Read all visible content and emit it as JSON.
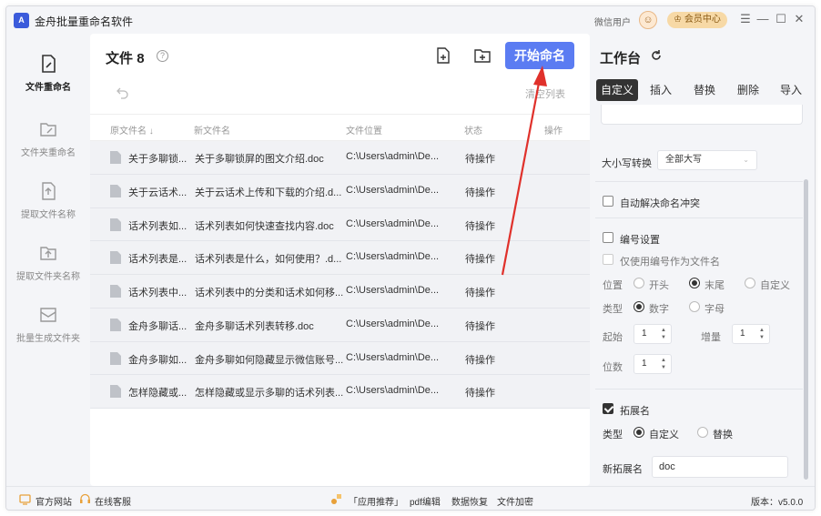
{
  "app": {
    "title": "金舟批量重命名软件",
    "logo_text": "A",
    "wx_user": "微信用户",
    "vip_label": "会员中心",
    "colors": {
      "accent": "#5b7cf2",
      "annotation": "#e0312b",
      "vip_bg": "#f7d9a6"
    }
  },
  "window_controls": {
    "menu": "☰",
    "minimize": "—",
    "maximize": "☐",
    "close": "✕"
  },
  "sidebar": {
    "items": [
      {
        "label": "文件重命名",
        "icon": "file-rename-icon"
      },
      {
        "label": "文件夹重命名",
        "icon": "folder-rename-icon"
      },
      {
        "label": "提取文件名称",
        "icon": "extract-file-name-icon"
      },
      {
        "label": "提取文件夹名称",
        "icon": "extract-folder-name-icon"
      },
      {
        "label": "批量生成文件夹",
        "icon": "batch-folder-icon"
      }
    ]
  },
  "main": {
    "title_label": "文件",
    "file_count": "8",
    "help": "?",
    "start_button": "开始命名",
    "clear_list": "清空列表",
    "columns": {
      "original_name": "原文件名 ↓",
      "new_name": "新文件名",
      "location": "文件位置",
      "status": "状态",
      "action": "操作"
    },
    "rows": [
      {
        "original": "关于多聊锁...",
        "new": "关于多聊锁屏的图文介绍.doc",
        "location": "C:\\Users\\admin\\De...",
        "status": "待操作"
      },
      {
        "original": "关于云话术...",
        "new": "关于云话术上传和下载的介绍.d...",
        "location": "C:\\Users\\admin\\De...",
        "status": "待操作"
      },
      {
        "original": "话术列表如...",
        "new": "话术列表如何快速查找内容.doc",
        "location": "C:\\Users\\admin\\De...",
        "status": "待操作"
      },
      {
        "original": "话术列表是...",
        "new": "话术列表是什么，如何使用？.d...",
        "location": "C:\\Users\\admin\\De...",
        "status": "待操作"
      },
      {
        "original": "话术列表中...",
        "new": "话术列表中的分类和话术如何移...",
        "location": "C:\\Users\\admin\\De...",
        "status": "待操作"
      },
      {
        "original": "金舟多聊话...",
        "new": "金舟多聊话术列表转移.doc",
        "location": "C:\\Users\\admin\\De...",
        "status": "待操作"
      },
      {
        "original": "金舟多聊如...",
        "new": "金舟多聊如何隐藏显示微信账号...",
        "location": "C:\\Users\\admin\\De...",
        "status": "待操作"
      },
      {
        "original": "怎样隐藏或...",
        "new": "怎样隐藏或显示多聊的话术列表...",
        "location": "C:\\Users\\admin\\De...",
        "status": "待操作"
      }
    ]
  },
  "workspace": {
    "title": "工作台",
    "tabs": [
      "自定义",
      "插入",
      "替换",
      "删除",
      "导入"
    ],
    "active_tab": "自定义",
    "case_label": "大小写转换",
    "case_value": "全部大写",
    "auto_resolve": "自动解决命名冲突",
    "numbering": {
      "label": "编号设置",
      "only_number": "仅使用编号作为文件名",
      "position_label": "位置",
      "position_options": [
        "开头",
        "末尾",
        "自定义"
      ],
      "position_selected": "末尾",
      "type_label": "类型",
      "type_options": [
        "数字",
        "字母"
      ],
      "type_selected": "数字",
      "start_label": "起始",
      "start_value": "1",
      "increment_label": "增量",
      "increment_value": "1",
      "digits_label": "位数",
      "digits_value": "1"
    },
    "extension": {
      "label": "拓展名",
      "checked": true,
      "type_label": "类型",
      "type_options": [
        "自定义",
        "替换"
      ],
      "type_selected": "自定义",
      "new_ext_label": "新拓展名",
      "new_ext_value": "doc"
    }
  },
  "bottombar": {
    "website": "官方网站",
    "service": "在线客服",
    "recommend": "「应用推荐」",
    "links": [
      "pdf编辑",
      "数据恢复",
      "文件加密"
    ],
    "version": "版本：v5.0.0"
  }
}
